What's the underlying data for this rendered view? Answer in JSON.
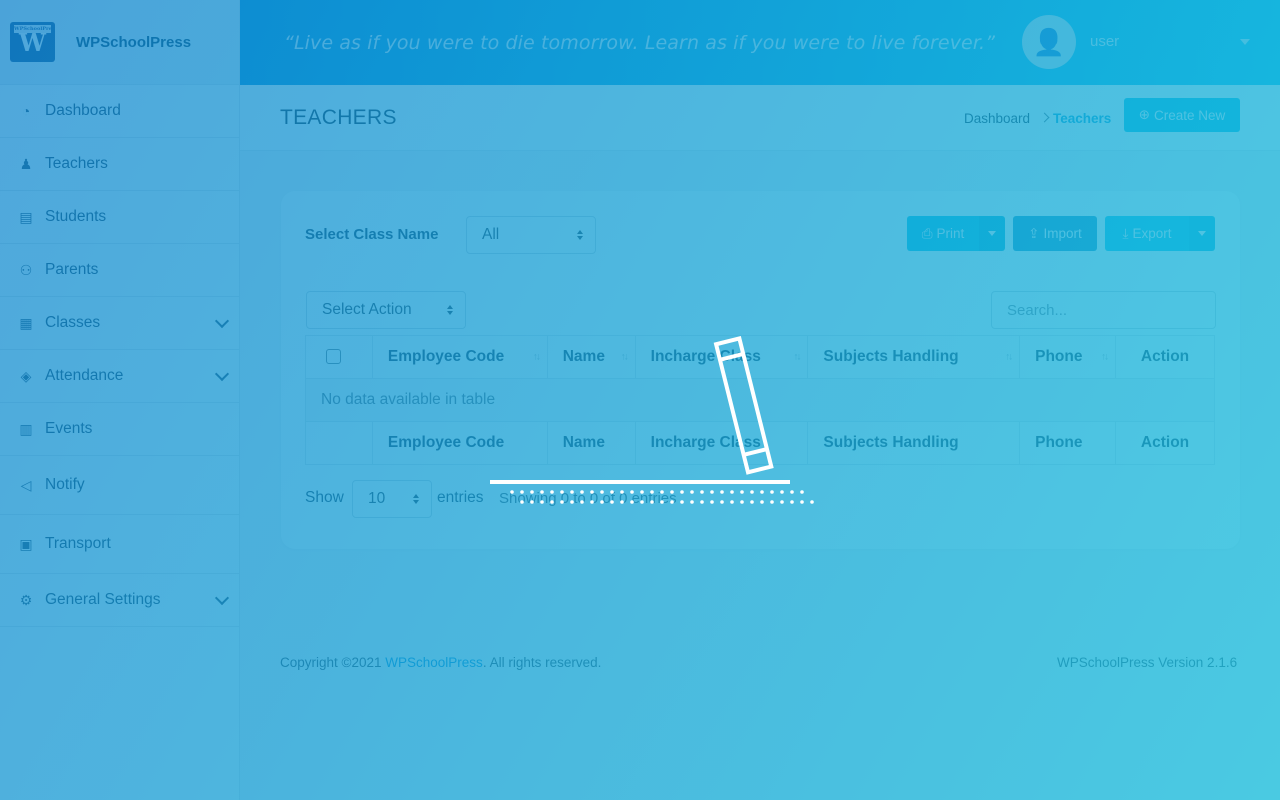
{
  "brand": {
    "name": "WPSchoolPress",
    "logo_text": "W",
    "logo_roof": "WPSchoolPress"
  },
  "sidebar": {
    "items": [
      {
        "label": "Dashboard",
        "icon": "dashboard-gauge-icon",
        "glyph": "◔"
      },
      {
        "label": "Teachers",
        "icon": "teacher-user-icon",
        "glyph": "♟"
      },
      {
        "label": "Students",
        "icon": "id-card-icon",
        "glyph": "▤"
      },
      {
        "label": "Parents",
        "icon": "group-users-icon",
        "glyph": "⚇"
      },
      {
        "label": "Classes",
        "icon": "classes-table-icon",
        "glyph": "▦"
      },
      {
        "label": "Attendance",
        "icon": "ticket-icon",
        "glyph": "◈"
      },
      {
        "label": "Events",
        "icon": "calendar-icon",
        "glyph": "▥"
      },
      {
        "label": "Notify",
        "icon": "megaphone-icon",
        "glyph": "◁"
      },
      {
        "label": "Transport",
        "icon": "bus-icon",
        "glyph": "▣"
      },
      {
        "label": "General Settings",
        "icon": "gear-icon",
        "glyph": "⚙"
      }
    ]
  },
  "topbar": {
    "quote": "“Live as if you were to die tomorrow. Learn as if you were to live forever.”",
    "username": "user",
    "avatar_glyph": "👤"
  },
  "page": {
    "title": "TEACHERS",
    "breadcrumb_home": "Dashboard",
    "breadcrumb_current": "Teachers",
    "create_label": "Create New"
  },
  "filters": {
    "class_label": "Select Class Name",
    "class_value": "All",
    "print_label": "Print",
    "import_label": "Import",
    "export_label": "Export",
    "action_value": "Select Action",
    "search_placeholder": "Search..."
  },
  "table": {
    "columns": [
      "Employee Code",
      "Name",
      "Incharge Class",
      "Subjects Handling",
      "Phone",
      "Action"
    ],
    "empty_message": "No data available in table",
    "show_label": "Show",
    "page_length": "10",
    "entries_label": "entries",
    "info": "Showing 0 to 0 of 0 entries"
  },
  "footer": {
    "copyright_prefix": "Copyright ©2021 ",
    "copyright_link": "WPSchoolPress",
    "copyright_suffix": ". All rights reserved.",
    "version": "WPSchoolPress Version 2.1.6"
  },
  "colors": {
    "topbar_start": "#0a8fd8",
    "topbar_end": "#13c6f0",
    "accent": "#06c1e6",
    "print_button": "#06c1e6",
    "import_button": "#1c99c9",
    "export_button": "#10c9ec"
  }
}
